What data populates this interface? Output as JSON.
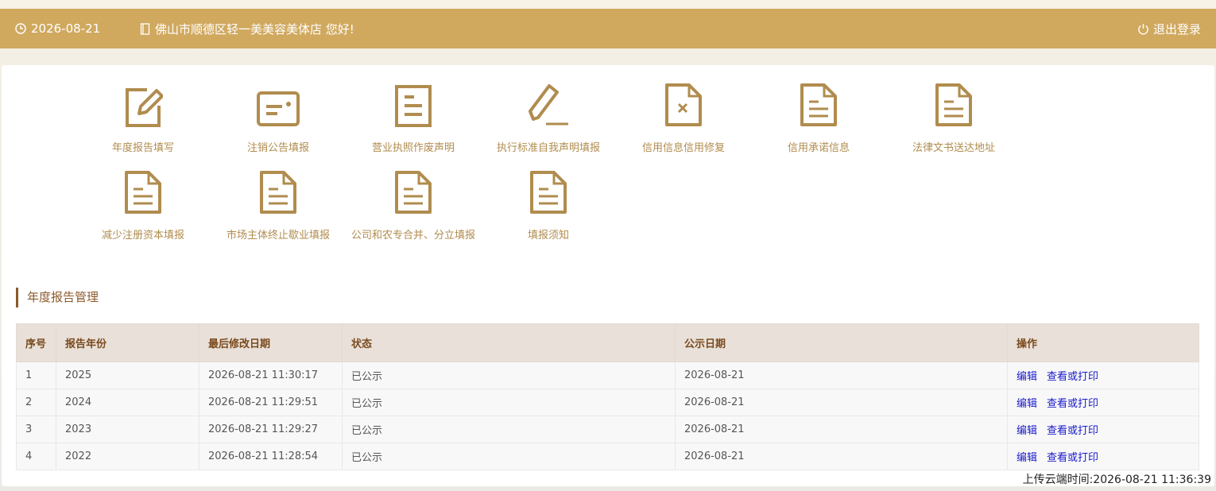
{
  "header": {
    "date": "2026-08-21",
    "greeting": "佛山市顺德区轻一美美容美体店 您好!",
    "logout_label": "退出登录",
    "icons": {
      "date": "clock-icon",
      "shop": "door-icon",
      "logout": "power-icon"
    }
  },
  "tiles": [
    {
      "label": "年度报告填写",
      "icon": "edit-square-icon"
    },
    {
      "label": "注销公告填报",
      "icon": "id-card-icon"
    },
    {
      "label": "营业执照作废声明",
      "icon": "document-lines-icon"
    },
    {
      "label": "执行标准自我声明填报",
      "icon": "pencil-icon"
    },
    {
      "label": "信用信息信用修复",
      "icon": "document-x-icon"
    },
    {
      "label": "信用承诺信息",
      "icon": "document-icon"
    },
    {
      "label": "法律文书送达地址",
      "icon": "document-icon"
    },
    {
      "label": "减少注册资本填报",
      "icon": "document-icon"
    },
    {
      "label": "市场主体终止歇业填报",
      "icon": "document-icon"
    },
    {
      "label": "公司和农专合并、分立填报",
      "icon": "document-icon"
    },
    {
      "label": "填报须知",
      "icon": "document-icon"
    }
  ],
  "section": {
    "title": "年度报告管理"
  },
  "table": {
    "headers": [
      "序号",
      "报告年份",
      "最后修改日期",
      "状态",
      "公示日期",
      "操作"
    ],
    "rows": [
      {
        "no": "1",
        "year": "2025",
        "modified": "2026-08-21 11:30:17",
        "status": "已公示",
        "publish_date": "2026-08-21"
      },
      {
        "no": "2",
        "year": "2024",
        "modified": "2026-08-21 11:29:51",
        "status": "已公示",
        "publish_date": "2026-08-21"
      },
      {
        "no": "3",
        "year": "2023",
        "modified": "2026-08-21 11:29:27",
        "status": "已公示",
        "publish_date": "2026-08-21"
      },
      {
        "no": "4",
        "year": "2022",
        "modified": "2026-08-21 11:28:54",
        "status": "已公示",
        "publish_date": "2026-08-21"
      }
    ],
    "actions": {
      "edit": "编辑",
      "view_print": "查看或打印"
    }
  },
  "footer": {
    "upload_time": "上传云端时间:2026-08-21 11:36:39"
  },
  "colors": {
    "accent": "#d0a95f",
    "icon": "#b08c4e",
    "title": "#8b5a2b",
    "link": "#1a1acc"
  }
}
